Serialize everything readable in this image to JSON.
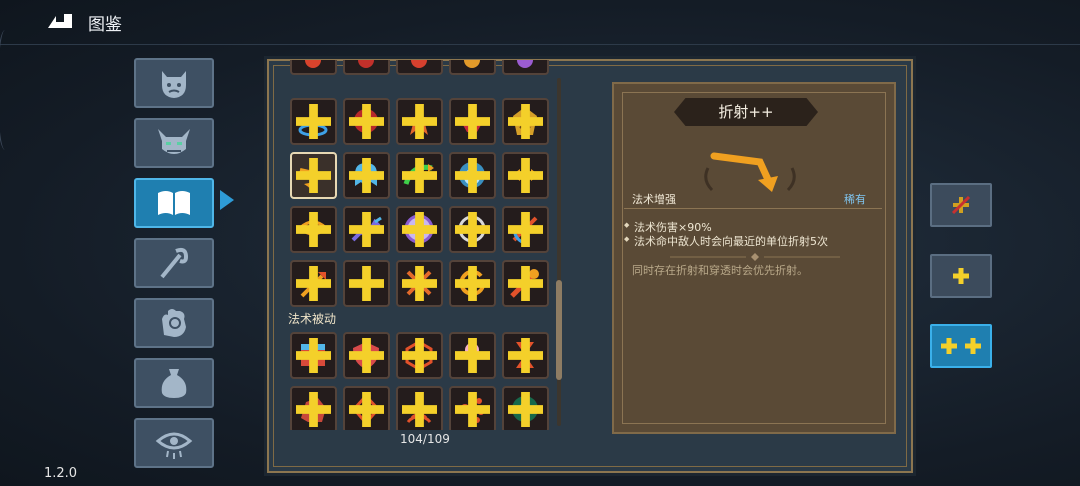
{
  "header": {
    "title": "图鉴",
    "back_icon": "back-arrow-icon"
  },
  "version": "1.2.0",
  "nav": {
    "items": [
      {
        "name": "nav-demon-face",
        "icon": "demon-face-icon",
        "active": false
      },
      {
        "name": "nav-horned-mask",
        "icon": "horned-mask-icon",
        "active": false
      },
      {
        "name": "nav-book",
        "icon": "book-icon",
        "active": true
      },
      {
        "name": "nav-staff",
        "icon": "staff-icon",
        "active": false
      },
      {
        "name": "nav-hand",
        "icon": "hand-icon",
        "active": false
      },
      {
        "name": "nav-pouch",
        "icon": "pouch-icon",
        "active": false
      },
      {
        "name": "nav-eye",
        "icon": "eye-icon",
        "active": false
      }
    ]
  },
  "grid": {
    "section_passive_label": "法术被动",
    "count": "104/109"
  },
  "detail": {
    "title": "折射++",
    "type": "法术增强",
    "rarity": "稀有",
    "effects": [
      "法术伤害×90%",
      "法术命中敌人时会向最近的单位折射5次"
    ],
    "note": "同时存在折射和穿透时会优先折射。",
    "colors": {
      "accent": "#1f7fb0",
      "rarity": "#7fc4ef",
      "card": "#5a4a36"
    }
  },
  "side_buttons": [
    {
      "name": "level-disabled-button",
      "icon": "crossed-plus-icon",
      "active": false
    },
    {
      "name": "level-plus-button",
      "icon": "plus-icon",
      "active": false
    },
    {
      "name": "level-plus-plus-button",
      "icon": "double-plus-icon",
      "active": true
    }
  ]
}
